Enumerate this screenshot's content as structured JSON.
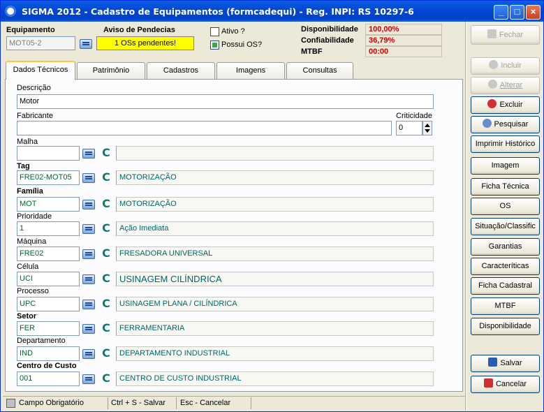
{
  "window": {
    "title": "SIGMA 2012 - Cadastro de Equipamentos  (formcadequi)  - Reg. INPI: RS 10297-6",
    "controls": {
      "minimize": "_",
      "maximize": "□",
      "close": "×"
    }
  },
  "header": {
    "equipamento_label": "Equipamento",
    "equipamento_value": "MOT05-2",
    "aviso_label": "Aviso de Pendecias",
    "aviso_value": "1  OSs pendentes!",
    "ativo_label": "Ativo ?",
    "possui_os_label": "Possui OS?",
    "disponibilidade_label": "Disponibilidade",
    "disponibilidade_value": "100,00%",
    "confiabilidade_label": "Confiabilidade",
    "confiabilidade_value": "36,79%",
    "mtbf_label": "MTBF",
    "mtbf_value": "00:00"
  },
  "tabs": [
    "Dados Técnicos",
    "Patrimônio",
    "Cadastros",
    "Imagens",
    "Consultas"
  ],
  "form": {
    "descricao_label": "Descrição",
    "descricao_value": "Motor",
    "fabricante_label": "Fabricante",
    "fabricante_value": "",
    "criticidade_label": "Criticidade",
    "criticidade_value": "0",
    "c_letter": "C",
    "rows": [
      {
        "label": "Malha",
        "code": "",
        "desc": ""
      },
      {
        "label": "Tag",
        "code": "FRE02-MOT05",
        "desc": "MOTORIZAÇÃO"
      },
      {
        "label": "Família",
        "code": "MOT",
        "desc": "MOTORIZAÇÃO"
      },
      {
        "label": "Prioridade",
        "code": "1",
        "desc": "Ação Imediata"
      },
      {
        "label": "Máquina",
        "code": "FRE02",
        "desc": "FRESADORA UNIVERSAL"
      },
      {
        "label": "Célula",
        "code": "UCI",
        "desc": "USINAGEM CILÍNDRICA"
      },
      {
        "label": "Processo",
        "code": "UPC",
        "desc": "USINAGEM PLANA / CILÍNDRICA"
      },
      {
        "label": "Setor",
        "code": "FER",
        "desc": "FERRAMENTARIA"
      },
      {
        "label": "Departamento",
        "code": "IND",
        "desc": "DEPARTAMENTO INDUSTRIAL"
      },
      {
        "label": "Centro de Custo",
        "code": "001",
        "desc": "CENTRO DE CUSTO INDUSTRIAL"
      }
    ]
  },
  "sidebar": {
    "fechar": "Fechar",
    "incluir": "Incluir",
    "alterar": "Alterar",
    "excluir": "Excluir",
    "pesquisar": "Pesquisar",
    "imprimir_historico": "Imprimir Histórico",
    "imagem": "Imagem",
    "ficha_tecnica": "Ficha Técnica",
    "os": "OS",
    "situacao": "Situação/Classific",
    "garantias": "Garantias",
    "caracteristicas": "Caracteríticas",
    "ficha_cadastral": "Ficha Cadastral",
    "mtbf": "MTBF",
    "disponibilidade": "Disponibilidade",
    "salvar": "Salvar",
    "cancelar": "Cancelar"
  },
  "status": {
    "campo_obrigatorio": "Campo Obrigatório",
    "salvar_hint": "Ctrl + S - Salvar",
    "cancelar_hint": "Esc - Cancelar"
  },
  "colors": {
    "accent_green": "#006633",
    "metric_red": "#cc0000",
    "aviso_yellow": "#ffff00"
  }
}
